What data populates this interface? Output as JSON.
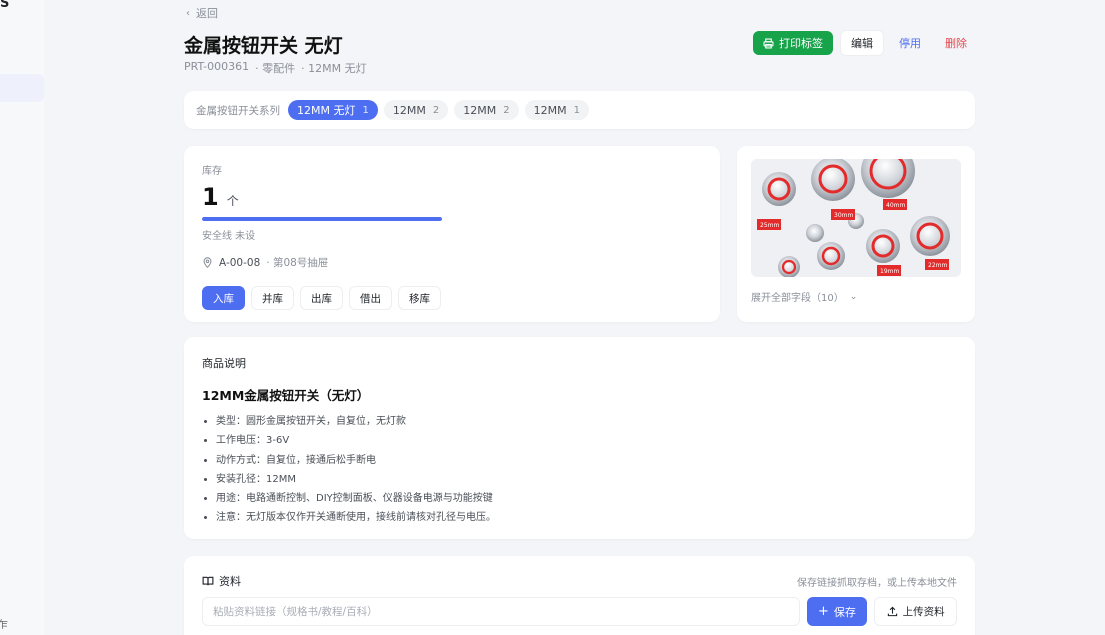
{
  "header": {
    "back_label": "返回",
    "title": "金属按钮开关 无灯",
    "part_no": "PRT-000361",
    "category": "· 零配件",
    "spec": "· 12MM 无灯",
    "print_label": "打印标签",
    "edit_label": "编辑",
    "disable_label": "停用",
    "delete_label": "删除"
  },
  "series": {
    "label": "金属按钮开关系列",
    "chips": [
      {
        "label": "12MM 无灯",
        "count": "1"
      },
      {
        "label": "12MM",
        "count": "2"
      },
      {
        "label": "12MM",
        "count": "2"
      },
      {
        "label": "12MM",
        "count": "1"
      }
    ]
  },
  "stock": {
    "label": "库存",
    "quantity": "1",
    "unit": "个",
    "level": 1.0,
    "safety_line": "安全线 未设",
    "location": "A-00-08",
    "drawer": "· 第08号抽屉",
    "ops": [
      "入库",
      "并库",
      "出库",
      "借出",
      "移库"
    ]
  },
  "image_card": {
    "expand_label": "展开全部字段（10）",
    "photo_labels": [
      "25mm",
      "30mm",
      "40mm",
      "19mm",
      "22mm"
    ]
  },
  "description": {
    "heading": "商品说明",
    "product_title": "12MM金属按钮开关（无灯）",
    "items": [
      "类型：圆形金属按钮开关，自复位，无灯款",
      "工作电压：3-6V",
      "动作方式：自复位，接通后松手断电",
      "安装孔径：12MM",
      "用途：电路通断控制、DIY控制面板、仪器设备电源与功能按键",
      "注意：无灯版本仅作开关通断使用，接线前请核对孔径与电压。"
    ]
  },
  "materials": {
    "heading": "资料",
    "hint": "保存链接抓取存档，或上传本地文件",
    "input_placeholder": "粘贴资料链接（规格书/教程/百科）",
    "save_label": "保存",
    "upload_label": "上传资料"
  },
  "sidebar": {
    "corner_text": "S",
    "bottom_text": "乍"
  },
  "colors": {
    "accent": "#4e6ef2",
    "print_green": "#16a34a",
    "danger": "#e5484d"
  }
}
